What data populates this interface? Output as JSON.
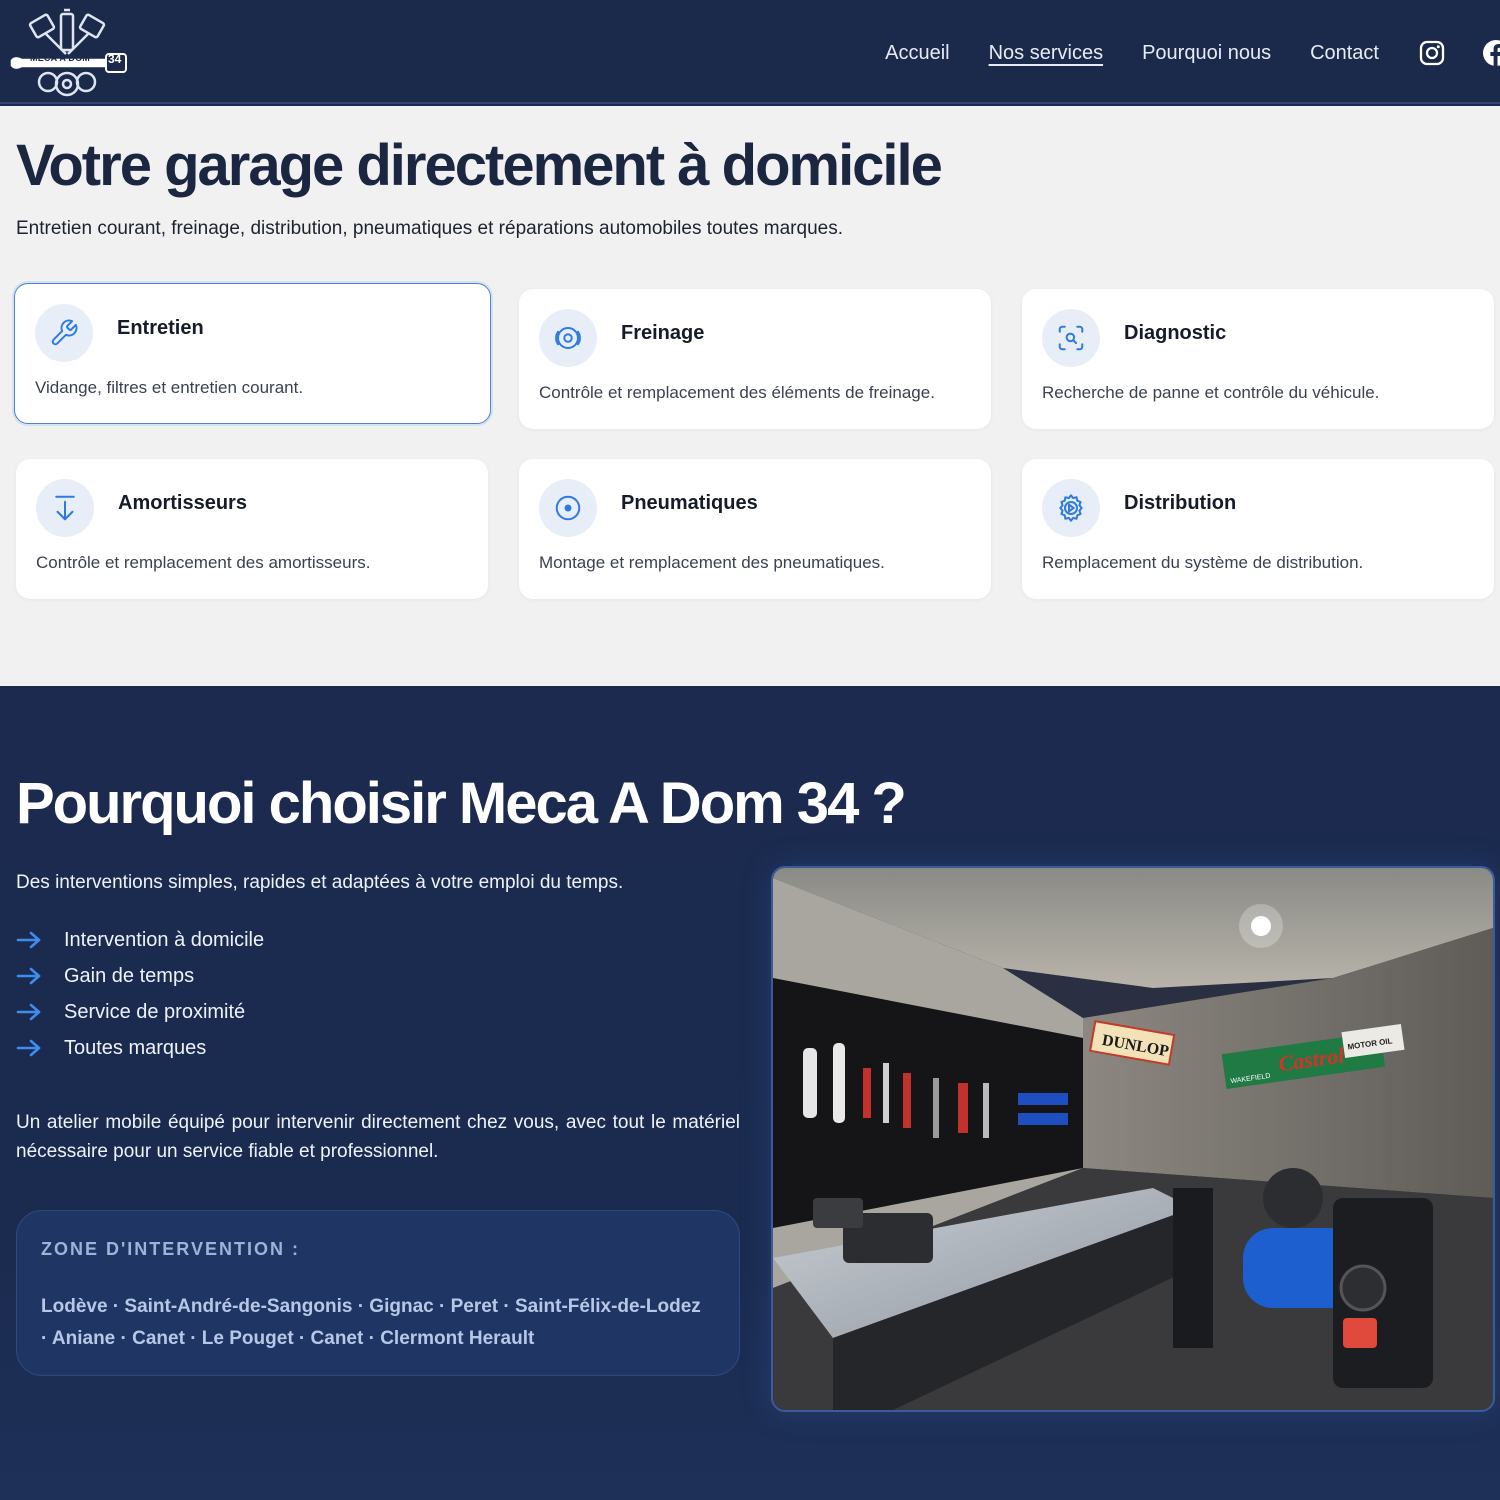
{
  "header": {
    "logo_text": "MECA A DOM",
    "logo_number": "34",
    "nav": [
      {
        "label": "Accueil"
      },
      {
        "label": "Nos services"
      },
      {
        "label": "Pourquoi nous"
      },
      {
        "label": "Contact"
      }
    ],
    "social_icons": [
      "instagram-icon",
      "facebook-icon"
    ]
  },
  "services": {
    "title": "Votre garage directement à domicile",
    "subtitle": "Entretien courant, freinage, distribution, pneumatiques et réparations automobiles toutes marques.",
    "cards": [
      {
        "icon": "wrench-icon",
        "title": "Entretien",
        "desc": "Vidange, filtres et entretien courant."
      },
      {
        "icon": "brake-disc-icon",
        "title": "Freinage",
        "desc": "Contrôle et remplacement des éléments de freinage."
      },
      {
        "icon": "diagnostic-scan-icon",
        "title": "Diagnostic",
        "desc": "Recherche de panne et contrôle du véhicule."
      },
      {
        "icon": "arrow-down-icon",
        "title": "Amortisseurs",
        "desc": "Contrôle et remplacement des amortisseurs."
      },
      {
        "icon": "tire-icon",
        "title": "Pneumatiques",
        "desc": "Montage et remplacement des pneumatiques."
      },
      {
        "icon": "gear-icon",
        "title": "Distribution",
        "desc": "Remplacement du système de distribution."
      }
    ]
  },
  "why": {
    "title": "Pourquoi choisir Meca A Dom 34 ?",
    "subtitle": "Des interventions simples, rapides et adaptées à votre emploi du temps.",
    "list": [
      {
        "label": "Intervention à domicile"
      },
      {
        "label": "Gain de temps"
      },
      {
        "label": "Service de proximité"
      },
      {
        "label": "Toutes marques"
      }
    ],
    "paragraph": "Un atelier mobile équipé pour intervenir directement chez vous, avec tout le matériel nécessaire pour un service fiable et professionnel.",
    "zone_title": "ZONE D'INTERVENTION :",
    "zone_list": "Lodève · Saint-André-de-Sangonis · Gignac · Peret · Saint-Félix-de-Lodez · Aniane · Canet · Le Pouget · Canet · Clermont Herault",
    "photo_signs": {
      "dunlop": "DUNLOP",
      "castrol": "Castrol",
      "motor_oil": "MOTOR OIL",
      "wakefield": "WAKEFIELD"
    }
  },
  "colors": {
    "navy": "#1b2a4a",
    "accent": "#2f7ae0",
    "light_bg": "#f1f1f2"
  }
}
